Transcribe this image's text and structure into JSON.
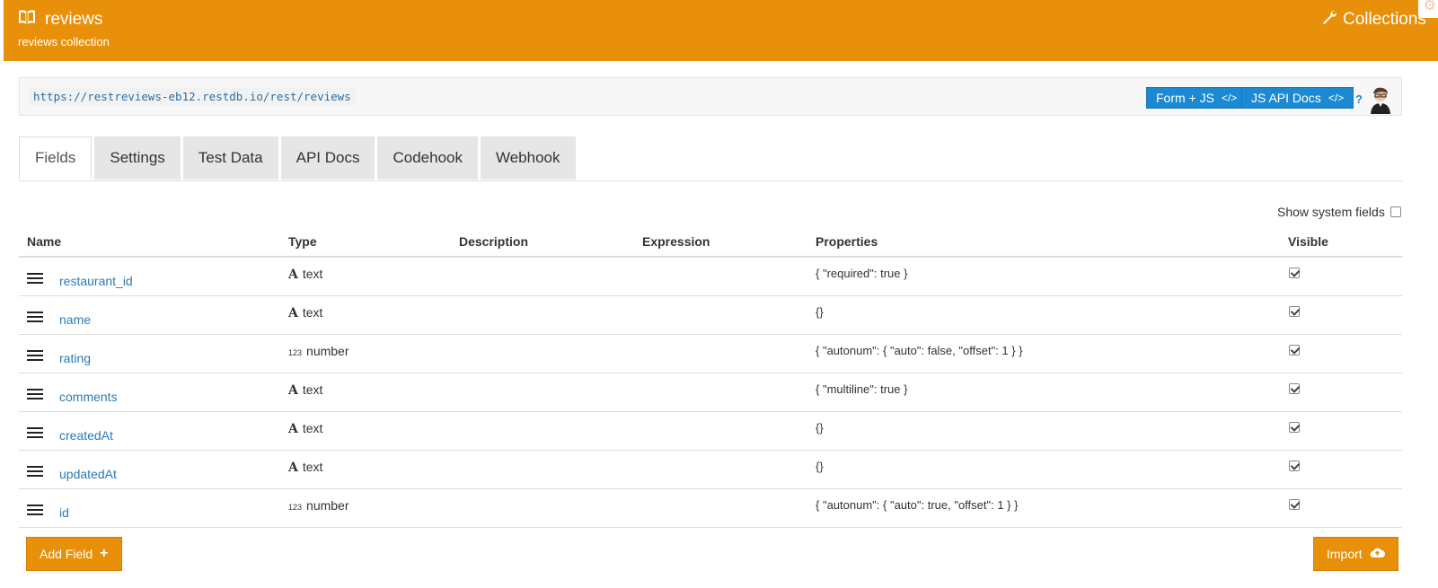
{
  "header": {
    "title": "reviews",
    "subtitle": "reviews collection",
    "right_label": "Collections"
  },
  "url_bar": {
    "url": "https://restreviews-eb12.restdb.io/rest/reviews",
    "form_js_label": "Form + JS",
    "js_api_docs_label": "JS API Docs",
    "help_label": "?"
  },
  "tabs": [
    {
      "label": "Fields",
      "active": true
    },
    {
      "label": "Settings"
    },
    {
      "label": "Test Data"
    },
    {
      "label": "API Docs"
    },
    {
      "label": "Codehook"
    },
    {
      "label": "Webhook"
    }
  ],
  "show_system_fields_label": "Show system fields",
  "table": {
    "headers": {
      "name": "Name",
      "type": "Type",
      "description": "Description",
      "expression": "Expression",
      "properties": "Properties",
      "visible": "Visible"
    },
    "rows": [
      {
        "name": "restaurant_id",
        "type": "text",
        "type_icon": "A",
        "properties": "{ \"required\": true }",
        "visible": true
      },
      {
        "name": "name",
        "type": "text",
        "type_icon": "A",
        "properties": "{}",
        "visible": true
      },
      {
        "name": "rating",
        "type": "number",
        "type_icon": "123",
        "properties": "{ \"autonum\": { \"auto\": false, \"offset\": 1 } }",
        "visible": true
      },
      {
        "name": "comments",
        "type": "text",
        "type_icon": "A",
        "properties": "{ \"multiline\": true }",
        "visible": true
      },
      {
        "name": "createdAt",
        "type": "text",
        "type_icon": "A",
        "properties": "{}",
        "visible": true
      },
      {
        "name": "updatedAt",
        "type": "text",
        "type_icon": "A",
        "properties": "{}",
        "visible": true
      },
      {
        "name": "id",
        "type": "number",
        "type_icon": "123",
        "properties": "{ \"autonum\": { \"auto\": true, \"offset\": 1 } }",
        "visible": true
      }
    ]
  },
  "buttons": {
    "add_field": "Add Field",
    "import": "Import"
  },
  "colors": {
    "header_orange": "#e8900a",
    "link_blue": "#2a7ab5",
    "button_blue": "#1c8ad2"
  }
}
